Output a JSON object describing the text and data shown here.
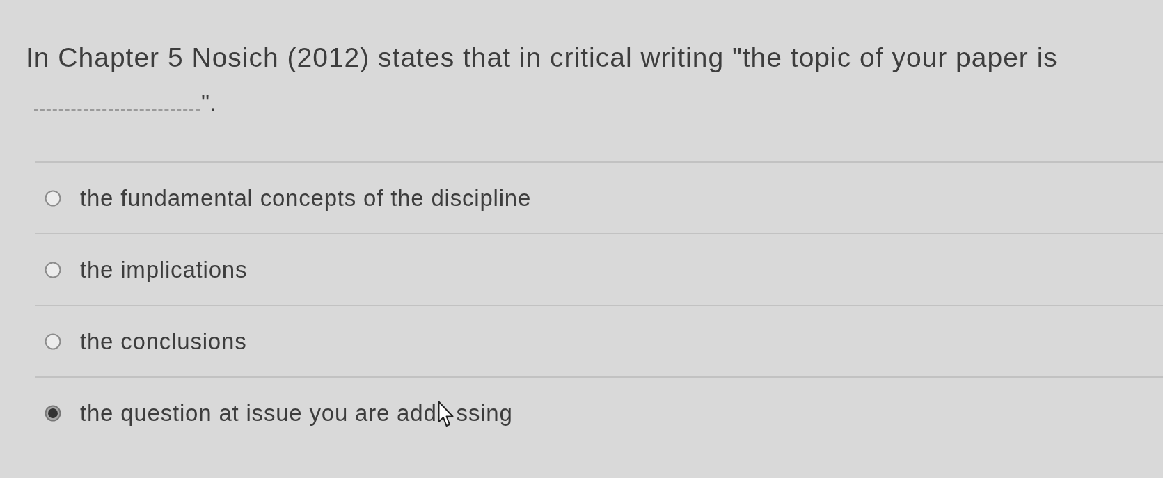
{
  "question": {
    "parts": [
      {
        "kind": "text",
        "text": "In Chapter 5 Nosich (2012) states that in critical writing \"the topic of your paper is"
      },
      {
        "kind": "blank"
      },
      {
        "kind": "text",
        "text": "\"."
      }
    ]
  },
  "options": [
    {
      "label": "the fundamental concepts of the discipline",
      "selected": false
    },
    {
      "label": "the implications",
      "selected": false
    },
    {
      "label": "the conclusions",
      "selected": false
    },
    {
      "label": "the question at issue you are add",
      "label_after_cursor": "ssing",
      "selected": true
    }
  ]
}
